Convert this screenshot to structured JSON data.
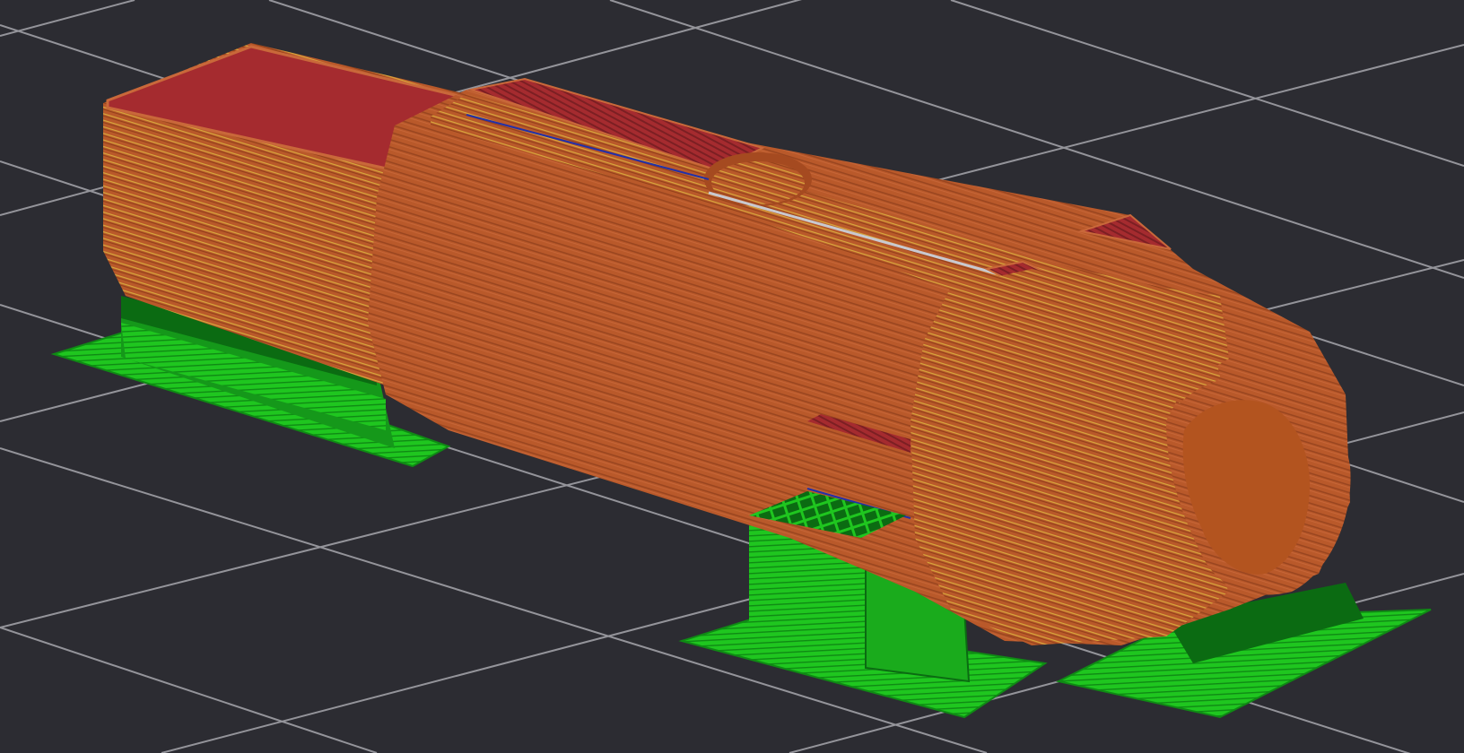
{
  "viewport": {
    "label": "",
    "background_color": "#2c2c32",
    "grid_color": "#a7a7ad",
    "grid": true
  },
  "scene": {
    "objects": [
      {
        "name": "model-body",
        "colors": {
          "wall": "#b9592a",
          "wall_dark": "#8f3f18",
          "top_layer": "#a52b2f",
          "infill_stripe": "#d7a83c"
        }
      },
      {
        "name": "support-material",
        "colors": {
          "support": "#1fc61f",
          "support_dark": "#0b6b12",
          "support_mid": "#15981a"
        }
      },
      {
        "name": "travel-moves",
        "colors": {
          "travel": "#c9c9cf",
          "retract": "#2230a8"
        }
      }
    ]
  }
}
